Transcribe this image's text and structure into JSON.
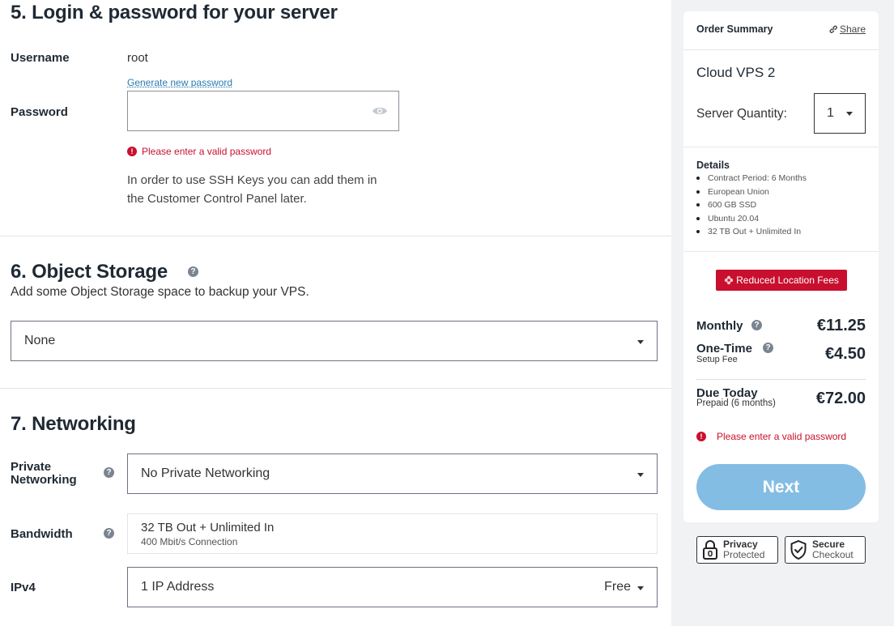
{
  "section5": {
    "title": "5. Login & password for your server",
    "username_label": "Username",
    "username_value": "root",
    "generate_link": "Generate new password",
    "password_label": "Password",
    "password_value": "",
    "error": "Please enter a valid password",
    "ssh_note_line1": "In order to use SSH Keys you can add them in",
    "ssh_note_line2": "the Customer Control Panel later."
  },
  "section6": {
    "title": "6. Object Storage",
    "help_icon": "question-icon",
    "subtitle": "Add some Object Storage space to backup your VPS.",
    "select_value": "None"
  },
  "section7": {
    "title": "7. Networking",
    "private_label_line1": "Private",
    "private_label_line2": "Networking",
    "private_value": "No Private Networking",
    "bandwidth_label": "Bandwidth",
    "bandwidth_value": "32 TB Out + Unlimited In",
    "bandwidth_sub": "400 Mbit/s Connection",
    "ipv4_label": "IPv4",
    "ipv4_value": "1 IP Address",
    "ipv4_price": "Free"
  },
  "summary": {
    "title": "Order Summary",
    "share": "Share",
    "product": "Cloud VPS 2",
    "quantity_label": "Server Quantity:",
    "quantity_value": "1",
    "details_title": "Details",
    "details": [
      "Contract Period: 6 Months",
      "European Union",
      "600 GB SSD",
      "Ubuntu 20.04",
      "32 TB Out + Unlimited In"
    ],
    "badge": "Reduced Location Fees",
    "monthly_label": "Monthly",
    "monthly_value": "€11.25",
    "onetime_label": "One-Time",
    "onetime_sub": "Setup Fee",
    "onetime_value": "€4.50",
    "due_label": "Due Today",
    "due_sub": "Prepaid (6 months)",
    "due_value": "€72.00",
    "error": "Please enter a valid password",
    "next": "Next"
  },
  "trust": {
    "privacy_line1": "Privacy",
    "privacy_line2": "Protected",
    "secure_line1": "Secure",
    "secure_line2": "Checkout"
  },
  "colors": {
    "accent_red": "#c8102e",
    "link_blue": "#2a7ab0",
    "next_button": "#84bde4",
    "sidebar_bg": "#f1f2f4"
  }
}
